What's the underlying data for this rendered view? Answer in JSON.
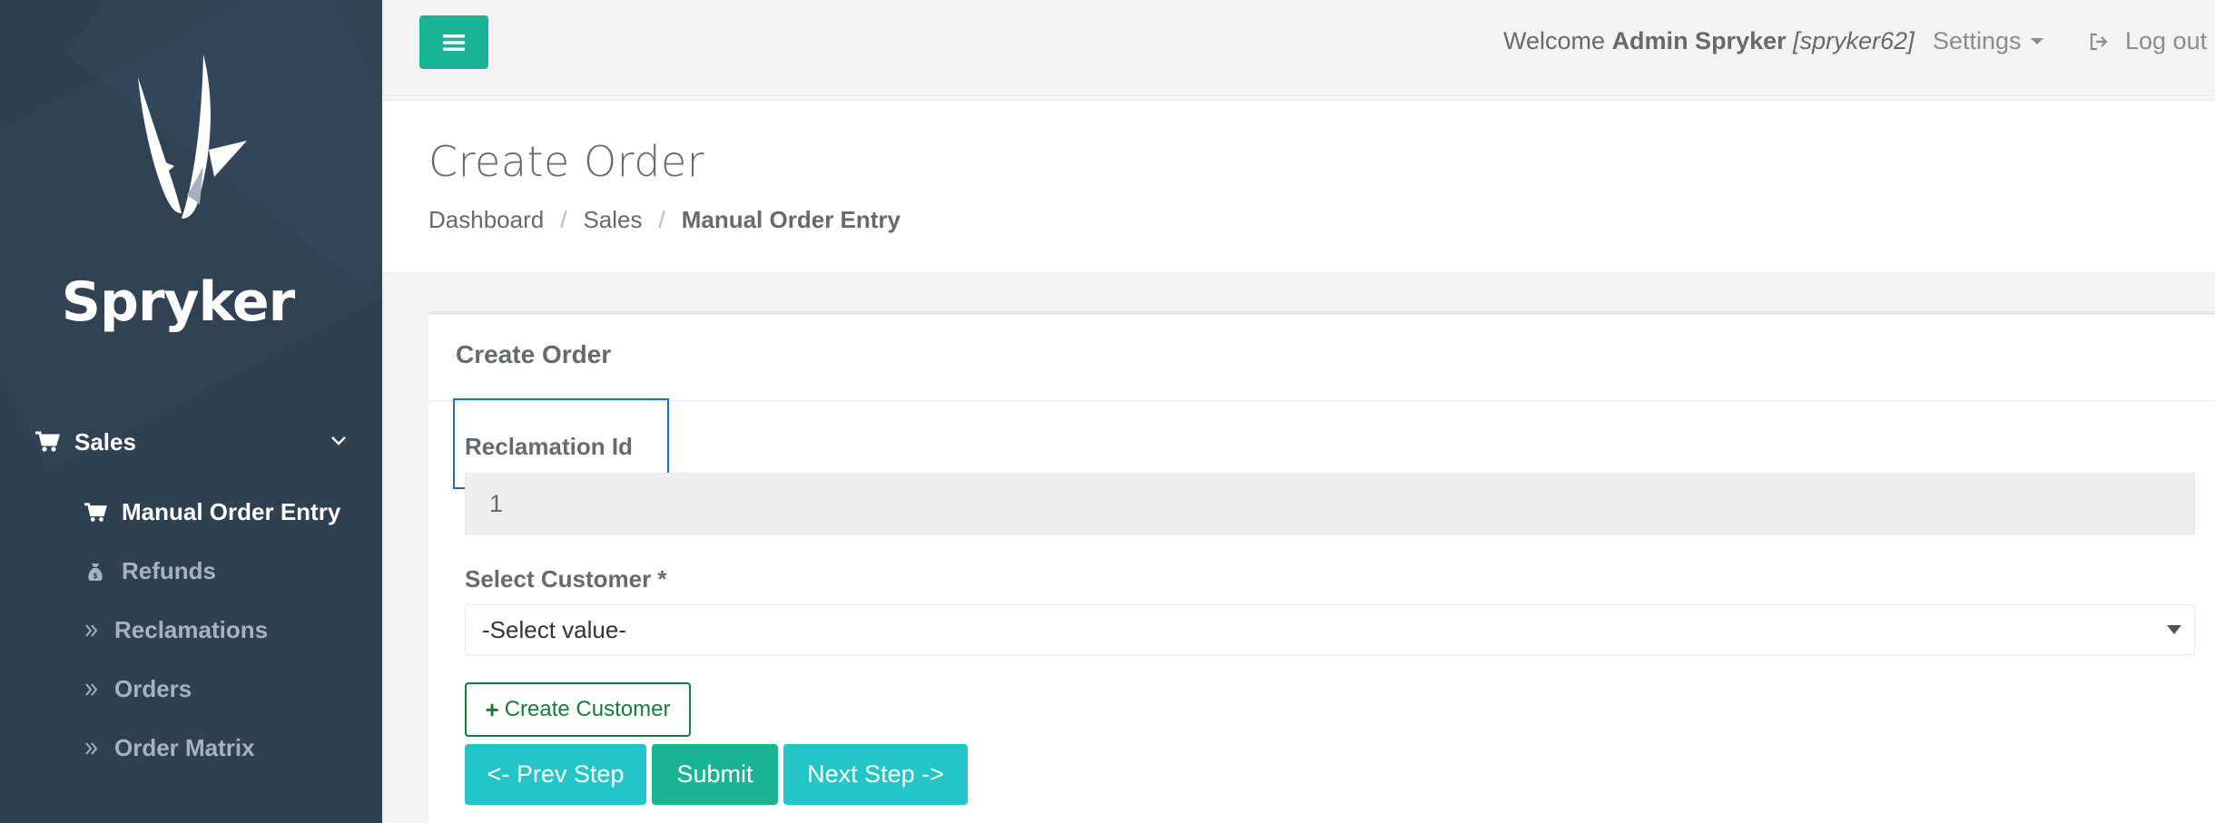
{
  "sidebar": {
    "logo_text": "Spryker",
    "sales_label": "Sales",
    "items": [
      {
        "label": "Manual Order Entry",
        "icon": "cart-icon",
        "active": true
      },
      {
        "label": "Refunds",
        "icon": "money-bag-icon",
        "active": false
      },
      {
        "label": "Reclamations",
        "icon": "double-chevron-icon",
        "active": false
      },
      {
        "label": "Orders",
        "icon": "double-chevron-icon",
        "active": false
      },
      {
        "label": "Order Matrix",
        "icon": "double-chevron-icon",
        "active": false
      }
    ]
  },
  "topbar": {
    "welcome_prefix": "Welcome",
    "user_name": "Admin Spryker",
    "user_login": "[spryker62]",
    "settings_label": "Settings",
    "logout_label": "Log out"
  },
  "heading": {
    "title": "Create Order",
    "breadcrumb": [
      "Dashboard",
      "Sales",
      "Manual Order Entry"
    ]
  },
  "panel": {
    "title": "Create Order",
    "reclamation_label": "Reclamation Id",
    "reclamation_value": "1",
    "customer_label": "Select Customer *",
    "customer_selected": "-Select value-",
    "create_customer_label": "Create Customer",
    "prev_label": "<- Prev Step",
    "submit_label": "Submit",
    "next_label": "Next Step ->"
  },
  "colors": {
    "sidebar_bg": "#2f4050",
    "primary": "#1ab394",
    "info": "#23c6c8",
    "create_customer": "#1a7a3d",
    "highlight": "#1f6fc1"
  }
}
